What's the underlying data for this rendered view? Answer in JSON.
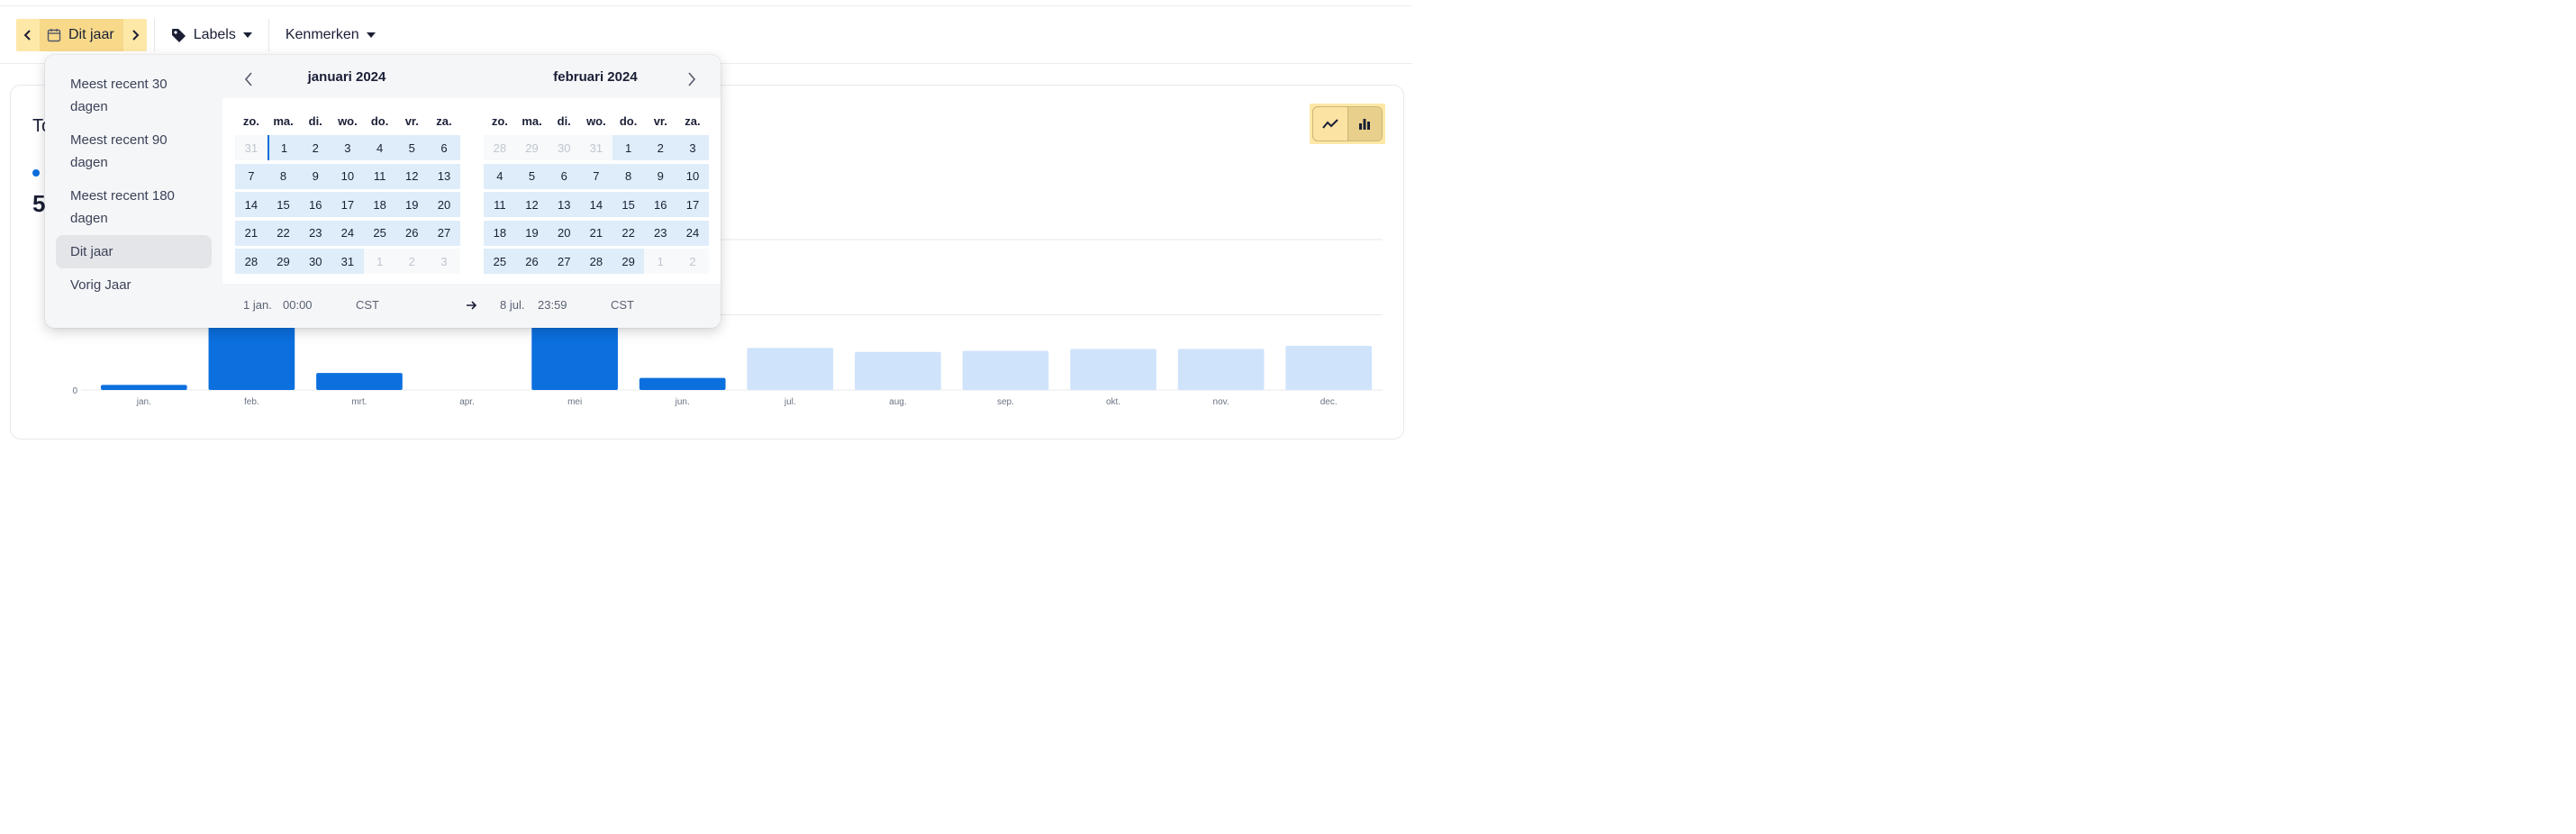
{
  "toolbar": {
    "date_label": "Dit jaar",
    "labels_label": "Labels",
    "kenmerken_label": "Kenmerken"
  },
  "card": {
    "title": "To",
    "big_number": "5"
  },
  "chart_data": {
    "type": "bar",
    "categories": [
      "jan.",
      "feb.",
      "mrt.",
      "apr.",
      "mei",
      "jun.",
      "jul.",
      "aug.",
      "sep.",
      "okt.",
      "nov.",
      "dec."
    ],
    "values": [
      5,
      190,
      17,
      0,
      220,
      12,
      42,
      38,
      39,
      41,
      41,
      44
    ],
    "projected": [
      false,
      false,
      false,
      false,
      false,
      false,
      true,
      true,
      true,
      true,
      true,
      true
    ],
    "yticks": [
      0,
      75
    ],
    "ylim": [
      0,
      150
    ],
    "grid": true,
    "colors": {
      "actual": "#0b6fde",
      "projected": "#cfe3fb"
    }
  },
  "popover": {
    "presets": [
      {
        "label": "Meest recent 30 dagen",
        "active": false
      },
      {
        "label": "Meest recent 90 dagen",
        "active": false
      },
      {
        "label": "Meest recent 180 dagen",
        "active": false
      },
      {
        "label": "Dit jaar",
        "active": true
      },
      {
        "label": "Vorig Jaar",
        "active": false
      }
    ],
    "weekdays": [
      "zo.",
      "ma.",
      "di.",
      "wo.",
      "do.",
      "vr.",
      "za."
    ],
    "months": [
      {
        "title": "januari 2024",
        "days": [
          {
            "d": "31",
            "out": true
          },
          {
            "d": "1",
            "start": true
          },
          {
            "d": "2"
          },
          {
            "d": "3"
          },
          {
            "d": "4"
          },
          {
            "d": "5"
          },
          {
            "d": "6"
          },
          {
            "d": "7"
          },
          {
            "d": "8"
          },
          {
            "d": "9"
          },
          {
            "d": "10"
          },
          {
            "d": "11"
          },
          {
            "d": "12"
          },
          {
            "d": "13"
          },
          {
            "d": "14"
          },
          {
            "d": "15"
          },
          {
            "d": "16"
          },
          {
            "d": "17"
          },
          {
            "d": "18"
          },
          {
            "d": "19"
          },
          {
            "d": "20"
          },
          {
            "d": "21"
          },
          {
            "d": "22"
          },
          {
            "d": "23"
          },
          {
            "d": "24"
          },
          {
            "d": "25"
          },
          {
            "d": "26"
          },
          {
            "d": "27"
          },
          {
            "d": "28"
          },
          {
            "d": "29"
          },
          {
            "d": "30"
          },
          {
            "d": "31"
          },
          {
            "d": "1",
            "out": true
          },
          {
            "d": "2",
            "out": true
          },
          {
            "d": "3",
            "out": true
          }
        ]
      },
      {
        "title": "februari 2024",
        "days": [
          {
            "d": "28",
            "out": true
          },
          {
            "d": "29",
            "out": true
          },
          {
            "d": "30",
            "out": true
          },
          {
            "d": "31",
            "out": true
          },
          {
            "d": "1"
          },
          {
            "d": "2"
          },
          {
            "d": "3"
          },
          {
            "d": "4"
          },
          {
            "d": "5"
          },
          {
            "d": "6"
          },
          {
            "d": "7"
          },
          {
            "d": "8"
          },
          {
            "d": "9"
          },
          {
            "d": "10"
          },
          {
            "d": "11"
          },
          {
            "d": "12"
          },
          {
            "d": "13"
          },
          {
            "d": "14"
          },
          {
            "d": "15"
          },
          {
            "d": "16"
          },
          {
            "d": "17"
          },
          {
            "d": "18"
          },
          {
            "d": "19"
          },
          {
            "d": "20"
          },
          {
            "d": "21"
          },
          {
            "d": "22"
          },
          {
            "d": "23"
          },
          {
            "d": "24"
          },
          {
            "d": "25"
          },
          {
            "d": "26"
          },
          {
            "d": "27"
          },
          {
            "d": "28"
          },
          {
            "d": "29"
          },
          {
            "d": "1",
            "out": true
          },
          {
            "d": "2",
            "out": true
          }
        ]
      }
    ],
    "footer": {
      "start_date": "1 jan.",
      "start_time": "00:00",
      "start_tz": "CST",
      "end_date": "8 jul.",
      "end_time": "23:59",
      "end_tz": "CST"
    }
  }
}
